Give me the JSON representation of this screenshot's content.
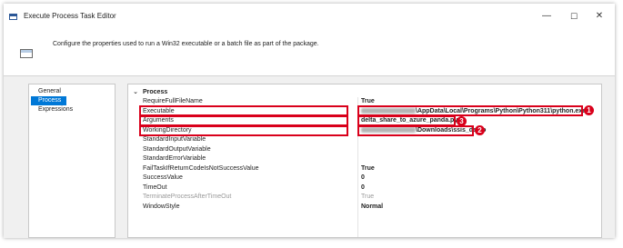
{
  "window": {
    "title": "Execute Process Task Editor",
    "minimize_glyph": "—",
    "maximize_glyph": "☐",
    "close_glyph": "✕"
  },
  "header": {
    "description": "Configure the properties used to run a Win32 executable or a batch file as part of the package."
  },
  "nav": {
    "items": [
      {
        "label": "General",
        "selected": false
      },
      {
        "label": "Process",
        "selected": true
      },
      {
        "label": "Expressions",
        "selected": false
      }
    ]
  },
  "grid": {
    "category": "Process",
    "chevron": "⌄",
    "properties": [
      {
        "name": "RequireFullFileName",
        "value": "True"
      },
      {
        "name": "Executable",
        "value": "\\AppData\\Local\\Programs\\Python\\Python311\\python.exe",
        "redacted_prefix": true
      },
      {
        "name": "Arguments",
        "value": "delta_share_to_azure_panda.py"
      },
      {
        "name": "WorkingDirectory",
        "value": "\\Downloads\\ssis_demo",
        "redacted_prefix": true
      },
      {
        "name": "StandardInputVariable",
        "value": ""
      },
      {
        "name": "StandardOutputVariable",
        "value": ""
      },
      {
        "name": "StandardErrorVariable",
        "value": ""
      },
      {
        "name": "FailTaskIfReturnCodeIsNotSuccessValue",
        "value": "True"
      },
      {
        "name": "SuccessValue",
        "value": "0"
      },
      {
        "name": "TimeOut",
        "value": "0"
      },
      {
        "name": "TerminateProcessAfterTimeOut",
        "value": "True",
        "disabled": true
      },
      {
        "name": "WindowStyle",
        "value": "Normal"
      }
    ]
  },
  "annotations": {
    "badge_1": "1",
    "badge_2": "2",
    "badge_3": "3",
    "highlight_color": "#d9001b"
  },
  "colors": {
    "selection": "#0078d7",
    "panel_bg": "#f0f0f0"
  }
}
